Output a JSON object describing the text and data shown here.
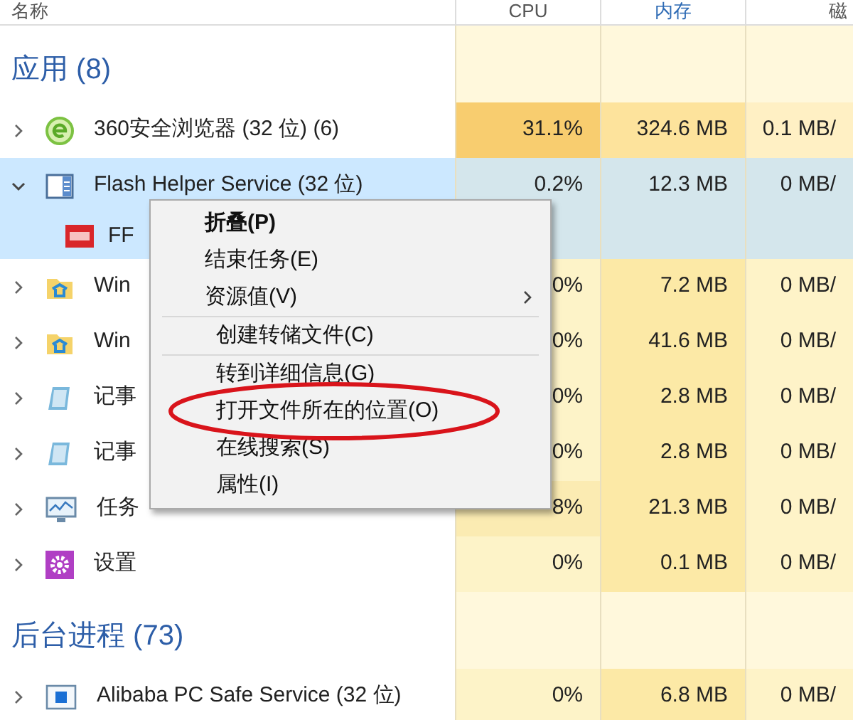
{
  "columns": [
    {
      "label": "名称"
    },
    {
      "label": "CPU"
    },
    {
      "label": "内存"
    },
    {
      "label": "磁"
    }
  ],
  "sections": [
    {
      "title": "应用 (8)",
      "processes": [
        {
          "name": "360安全浏览器 (32 位) (6)",
          "expanded": false,
          "selected": false,
          "cells": [
            {
              "text": "31.1%",
              "color": "#f8cd6f"
            },
            {
              "text": "324.6 MB",
              "color": "#fde39c"
            },
            {
              "text": "0.1 MB/",
              "color": "#fff0c4"
            }
          ]
        },
        {
          "name": "Flash Helper Service (32 位)",
          "expanded": true,
          "selected": true,
          "cells": [
            {
              "text": "0.2%",
              "color": "#d4e6ec"
            },
            {
              "text": "12.3 MB",
              "color": "#d4e6ec"
            },
            {
              "text": "0 MB/",
              "color": "#d4e6ec"
            }
          ],
          "children": [
            {
              "name": "FF",
              "selected": true
            }
          ]
        },
        {
          "name": "Win",
          "expanded": false,
          "selected": false,
          "cells": [
            {
              "text": "0%",
              "color": "#fdf3c8"
            },
            {
              "text": "7.2 MB",
              "color": "#fce9a6"
            },
            {
              "text": "0 MB/",
              "color": "#fef3c8"
            }
          ]
        },
        {
          "name": "Win",
          "expanded": false,
          "selected": false,
          "cells": [
            {
              "text": "0%",
              "color": "#fdf3c8"
            },
            {
              "text": "41.6 MB",
              "color": "#fce9a6"
            },
            {
              "text": "0 MB/",
              "color": "#fef3c8"
            }
          ]
        },
        {
          "name": "记事",
          "expanded": false,
          "selected": false,
          "cells": [
            {
              "text": "0%",
              "color": "#fdf3c8"
            },
            {
              "text": "2.8 MB",
              "color": "#fce9a6"
            },
            {
              "text": "0 MB/",
              "color": "#fef3c8"
            }
          ]
        },
        {
          "name": "记事",
          "expanded": false,
          "selected": false,
          "cells": [
            {
              "text": "0%",
              "color": "#fdf3c8"
            },
            {
              "text": "2.8 MB",
              "color": "#fce9a6"
            },
            {
              "text": "0 MB/",
              "color": "#fef3c8"
            }
          ]
        },
        {
          "name": "任务",
          "expanded": false,
          "selected": false,
          "cells": [
            {
              "text": "8%",
              "color": "#fbebb2"
            },
            {
              "text": "21.3 MB",
              "color": "#fce9a6"
            },
            {
              "text": "0 MB/",
              "color": "#fef3c8"
            }
          ]
        },
        {
          "name": "设置",
          "expanded": false,
          "selected": false,
          "cells": [
            {
              "text": "0%",
              "color": "#fdf3c8"
            },
            {
              "text": "0.1 MB",
              "color": "#fce9a6"
            },
            {
              "text": "0 MB/",
              "color": "#fef3c8"
            }
          ]
        }
      ]
    },
    {
      "title": "后台进程 (73)",
      "processes": [
        {
          "name": "Alibaba PC Safe Service (32 位)",
          "expanded": false,
          "selected": false,
          "cells": [
            {
              "text": "0%",
              "color": "#fdf3c8"
            },
            {
              "text": "6.8 MB",
              "color": "#fce9a6"
            },
            {
              "text": "0 MB/",
              "color": "#fef3c8"
            }
          ]
        }
      ]
    }
  ],
  "context_menu": {
    "sections": [
      [
        {
          "label": "折叠(P)",
          "bold": true,
          "submenu": false,
          "circled": false
        },
        {
          "label": "结束任务(E)",
          "bold": false,
          "submenu": false,
          "circled": false
        },
        {
          "label": "资源值(V)",
          "bold": false,
          "submenu": true,
          "circled": false
        }
      ],
      [
        {
          "label": "创建转储文件(C)",
          "bold": false,
          "submenu": false,
          "circled": false
        }
      ],
      [
        {
          "label": "转到详细信息(G)",
          "bold": false,
          "submenu": false,
          "circled": false
        },
        {
          "label": "打开文件所在的位置(O)",
          "bold": false,
          "submenu": false,
          "circled": true
        },
        {
          "label": "在线搜索(S)",
          "bold": false,
          "submenu": false,
          "circled": false
        },
        {
          "label": "属性(I)",
          "bold": false,
          "submenu": false,
          "circled": false
        }
      ]
    ]
  }
}
